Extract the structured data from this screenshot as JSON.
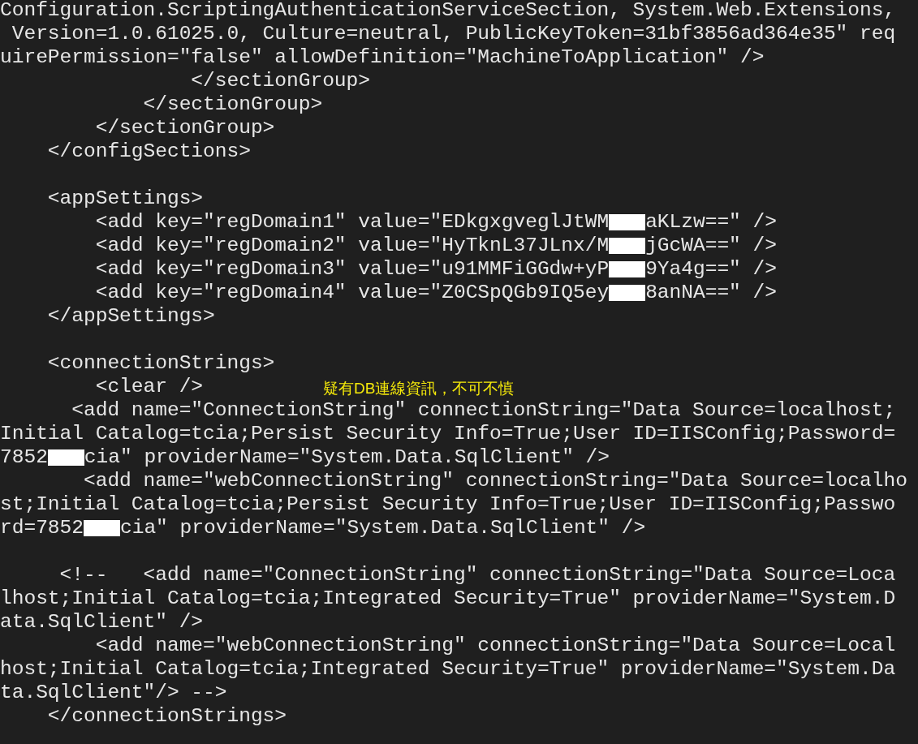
{
  "annotation": {
    "text": "疑有DB連線資訊，不可不慎"
  },
  "lines": [
    {
      "kind": "code",
      "segments": [
        {
          "kind": "text",
          "text": "Configuration.ScriptingAuthenticationServiceSection, System.Web.Extensions,"
        }
      ]
    },
    {
      "kind": "code",
      "segments": [
        {
          "kind": "text",
          "text": " Version=1.0.61025.0, Culture=neutral, PublicKeyToken=31bf3856ad364e35\" req"
        }
      ]
    },
    {
      "kind": "code",
      "segments": [
        {
          "kind": "text",
          "text": "uirePermission=\"false\" allowDefinition=\"MachineToApplication\" />"
        }
      ]
    },
    {
      "kind": "code",
      "segments": [
        {
          "kind": "text",
          "text": "                </sectionGroup>"
        }
      ]
    },
    {
      "kind": "code",
      "segments": [
        {
          "kind": "text",
          "text": "            </sectionGroup>"
        }
      ]
    },
    {
      "kind": "code",
      "segments": [
        {
          "kind": "text",
          "text": "        </sectionGroup>"
        }
      ]
    },
    {
      "kind": "code",
      "segments": [
        {
          "kind": "text",
          "text": "    </configSections>"
        }
      ]
    },
    {
      "kind": "blank"
    },
    {
      "kind": "code",
      "segments": [
        {
          "kind": "text",
          "text": "    <appSettings>"
        }
      ]
    },
    {
      "kind": "code",
      "segments": [
        {
          "kind": "text",
          "text": "        <add key=\"regDomain1\" value=\"EDkgxgveglJtWM"
        },
        {
          "kind": "redaction"
        },
        {
          "kind": "text",
          "text": "aKLzw==\" />"
        }
      ]
    },
    {
      "kind": "code",
      "segments": [
        {
          "kind": "text",
          "text": "        <add key=\"regDomain2\" value=\"HyTknL37JLnx/M"
        },
        {
          "kind": "redaction"
        },
        {
          "kind": "text",
          "text": "jGcWA==\" />"
        }
      ]
    },
    {
      "kind": "code",
      "segments": [
        {
          "kind": "text",
          "text": "        <add key=\"regDomain3\" value=\"u91MMFiGGdw+yP"
        },
        {
          "kind": "redaction"
        },
        {
          "kind": "text",
          "text": "9Ya4g==\" />"
        }
      ]
    },
    {
      "kind": "code",
      "segments": [
        {
          "kind": "text",
          "text": "        <add key=\"regDomain4\" value=\"Z0CSpQGb9IQ5ey"
        },
        {
          "kind": "redaction"
        },
        {
          "kind": "text",
          "text": "8anNA==\" />"
        }
      ]
    },
    {
      "kind": "code",
      "segments": [
        {
          "kind": "text",
          "text": "    </appSettings>"
        }
      ]
    },
    {
      "kind": "blank"
    },
    {
      "kind": "code",
      "segments": [
        {
          "kind": "text",
          "text": "    <connectionStrings>"
        }
      ]
    },
    {
      "kind": "code",
      "segments": [
        {
          "kind": "text",
          "text": "        <clear />"
        }
      ]
    },
    {
      "kind": "code",
      "segments": [
        {
          "kind": "text",
          "text": "      <add name=\"ConnectionString\" connectionString=\"Data Source=localhost;"
        }
      ]
    },
    {
      "kind": "code",
      "segments": [
        {
          "kind": "text",
          "text": "Initial Catalog=tcia;Persist Security Info=True;User ID=IISConfig;Password="
        }
      ]
    },
    {
      "kind": "code",
      "segments": [
        {
          "kind": "text",
          "text": "7852"
        },
        {
          "kind": "redaction"
        },
        {
          "kind": "text",
          "text": "cia\" providerName=\"System.Data.SqlClient\" />"
        }
      ]
    },
    {
      "kind": "code",
      "segments": [
        {
          "kind": "text",
          "text": "       <add name=\"webConnectionString\" connectionString=\"Data Source=localho"
        }
      ]
    },
    {
      "kind": "code",
      "segments": [
        {
          "kind": "text",
          "text": "st;Initial Catalog=tcia;Persist Security Info=True;User ID=IISConfig;Passwo"
        }
      ]
    },
    {
      "kind": "code",
      "segments": [
        {
          "kind": "text",
          "text": "rd=7852"
        },
        {
          "kind": "redaction"
        },
        {
          "kind": "text",
          "text": "cia\" providerName=\"System.Data.SqlClient\" />"
        }
      ]
    },
    {
      "kind": "blank"
    },
    {
      "kind": "code",
      "segments": [
        {
          "kind": "text",
          "text": "     <!--   <add name=\"ConnectionString\" connectionString=\"Data Source=Loca"
        }
      ]
    },
    {
      "kind": "code",
      "segments": [
        {
          "kind": "text",
          "text": "lhost;Initial Catalog=tcia;Integrated Security=True\" providerName=\"System.D"
        }
      ]
    },
    {
      "kind": "code",
      "segments": [
        {
          "kind": "text",
          "text": "ata.SqlClient\" />"
        }
      ]
    },
    {
      "kind": "code",
      "segments": [
        {
          "kind": "text",
          "text": "        <add name=\"webConnectionString\" connectionString=\"Data Source=Local"
        }
      ]
    },
    {
      "kind": "code",
      "segments": [
        {
          "kind": "text",
          "text": "host;Initial Catalog=tcia;Integrated Security=True\" providerName=\"System.Da"
        }
      ]
    },
    {
      "kind": "code",
      "segments": [
        {
          "kind": "text",
          "text": "ta.SqlClient\"/> -->"
        }
      ]
    },
    {
      "kind": "code",
      "segments": [
        {
          "kind": "text",
          "text": "    </connectionStrings>"
        }
      ]
    }
  ]
}
